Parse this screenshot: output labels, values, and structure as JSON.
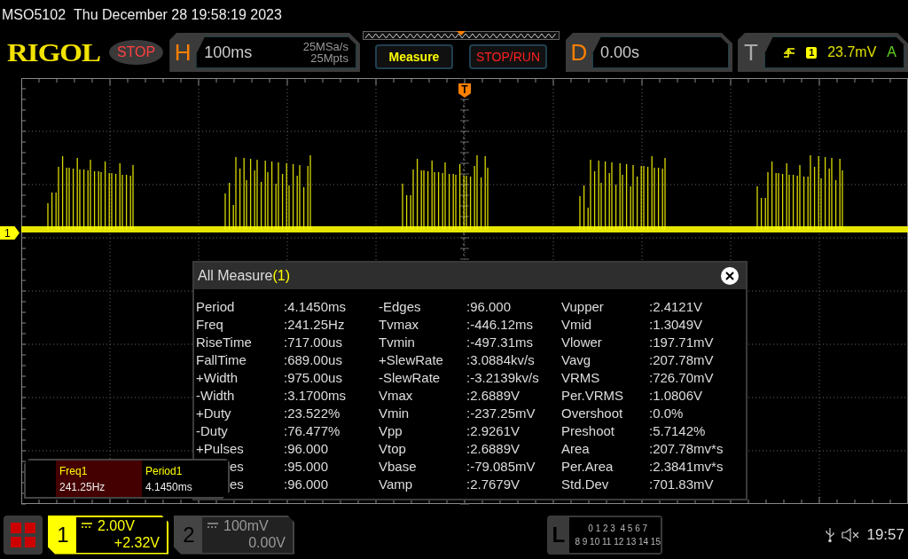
{
  "title_bar": {
    "model": "MSO5102",
    "datetime": "Thu December 28 19:58:19 2023"
  },
  "toolbar": {
    "logo": "RIGOL",
    "run_state": "STOP",
    "horizontal": {
      "label": "H",
      "timebase": "100ms",
      "sample_rate": "25MSa/s",
      "memory_depth": "25Mpts"
    },
    "buttons": [
      {
        "label": "Measure",
        "kind": "measure"
      },
      {
        "label": "STOP/RUN",
        "kind": "run"
      }
    ],
    "delay": {
      "label": "D",
      "value": "0.00s"
    },
    "trigger": {
      "label": "T",
      "source": "1",
      "level": "23.7mV",
      "mode": "A"
    }
  },
  "display": {
    "channel_marker": "1",
    "trigger_marker": "T"
  },
  "measure_dialog": {
    "title": "All Measure",
    "channel": "(1)",
    "rows": [
      {
        "cells": [
          {
            "name": "Period",
            "value": ":4.1450ms"
          },
          {
            "name": "-Edges",
            "value": ":96.000"
          },
          {
            "name": "Vupper",
            "value": ":2.4121V"
          }
        ]
      },
      {
        "cells": [
          {
            "name": "Freq",
            "value": ":241.25Hz"
          },
          {
            "name": "Tvmax",
            "value": ":-446.12ms"
          },
          {
            "name": "Vmid",
            "value": ":1.3049V"
          }
        ]
      },
      {
        "cells": [
          {
            "name": "RiseTime",
            "value": ":717.00us"
          },
          {
            "name": "Tvmin",
            "value": ":-497.31ms"
          },
          {
            "name": "Vlower",
            "value": ":197.71mV"
          }
        ]
      },
      {
        "cells": [
          {
            "name": "FallTime",
            "value": ":689.00us"
          },
          {
            "name": "+SlewRate",
            "value": ":3.0884kv/s"
          },
          {
            "name": "Vavg",
            "value": ":207.78mV"
          }
        ]
      },
      {
        "cells": [
          {
            "name": "+Width",
            "value": ":975.00us"
          },
          {
            "name": "-SlewRate",
            "value": ":-3.2139kv/s"
          },
          {
            "name": "VRMS",
            "value": ":726.70mV"
          }
        ]
      },
      {
        "cells": [
          {
            "name": "-Width",
            "value": ":3.1700ms"
          },
          {
            "name": "Vmax",
            "value": ":2.6889V"
          },
          {
            "name": "Per.VRMS",
            "value": ":1.0806V"
          }
        ]
      },
      {
        "cells": [
          {
            "name": "+Duty",
            "value": ":23.522%"
          },
          {
            "name": "Vmin",
            "value": ":-237.25mV"
          },
          {
            "name": "Overshoot",
            "value": ":0.0%"
          }
        ]
      },
      {
        "cells": [
          {
            "name": "-Duty",
            "value": ":76.477%"
          },
          {
            "name": "Vpp",
            "value": ":2.9261V"
          },
          {
            "name": "Preshoot",
            "value": ":5.7142%"
          }
        ]
      },
      {
        "cells": [
          {
            "name": "+Pulses",
            "value": ":96.000"
          },
          {
            "name": "Vtop",
            "value": ":2.6889V"
          },
          {
            "name": "Area",
            "value": ":207.78mv*s"
          }
        ]
      },
      {
        "cells": [
          {
            "name": "es",
            "value": ":95.000",
            "covered": true
          },
          {
            "name": "Vbase",
            "value": ":-79.085mV"
          },
          {
            "name": "Per.Area",
            "value": ":2.3841mv*s"
          }
        ]
      },
      {
        "cells": [
          {
            "name": "es",
            "value": ":96.000",
            "covered": true
          },
          {
            "name": "Vamp",
            "value": ":2.7679V"
          },
          {
            "name": "Std.Dev",
            "value": ":701.83mV"
          }
        ]
      }
    ]
  },
  "mini_panel": [
    {
      "label": "Freq1",
      "value": "241.25Hz",
      "selected": true
    },
    {
      "label": "Period1",
      "value": "4.1450ms",
      "selected": false
    }
  ],
  "channels": [
    {
      "number": "1",
      "scale": "2.00V",
      "offset": "+2.32V",
      "on": true
    },
    {
      "number": "2",
      "scale": "100mV",
      "offset": "0.00V",
      "on": false
    }
  ],
  "logic": {
    "label": "L",
    "row_1": "0 1 2 3  4 5 6 7",
    "row_2": "8 9 10 11 12 13 14 15"
  },
  "clock": "19:57"
}
